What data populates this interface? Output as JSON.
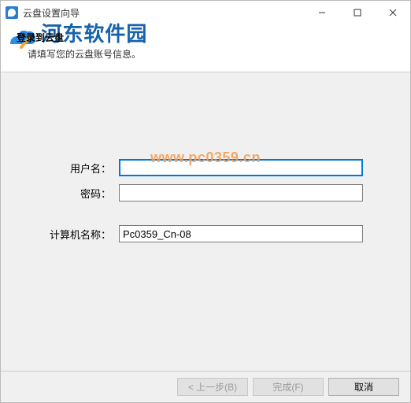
{
  "window": {
    "title": "云盘设置向导",
    "controls": {
      "min": "—",
      "max": "☐",
      "close": "✕"
    }
  },
  "header": {
    "title": "登录到云盘",
    "subtitle": "请填写您的云盘账号信息。"
  },
  "watermark": {
    "text": "河东软件园",
    "url": "www.pc0359.cn"
  },
  "form": {
    "username_label": "用户名：",
    "username_value": "",
    "password_label": "密码：",
    "password_value": "",
    "computer_label": "计算机名称：",
    "computer_value": "Pc0359_Cn-08"
  },
  "footer": {
    "back": "< 上一步(B)",
    "finish": "完成(F)",
    "cancel": "取消"
  }
}
